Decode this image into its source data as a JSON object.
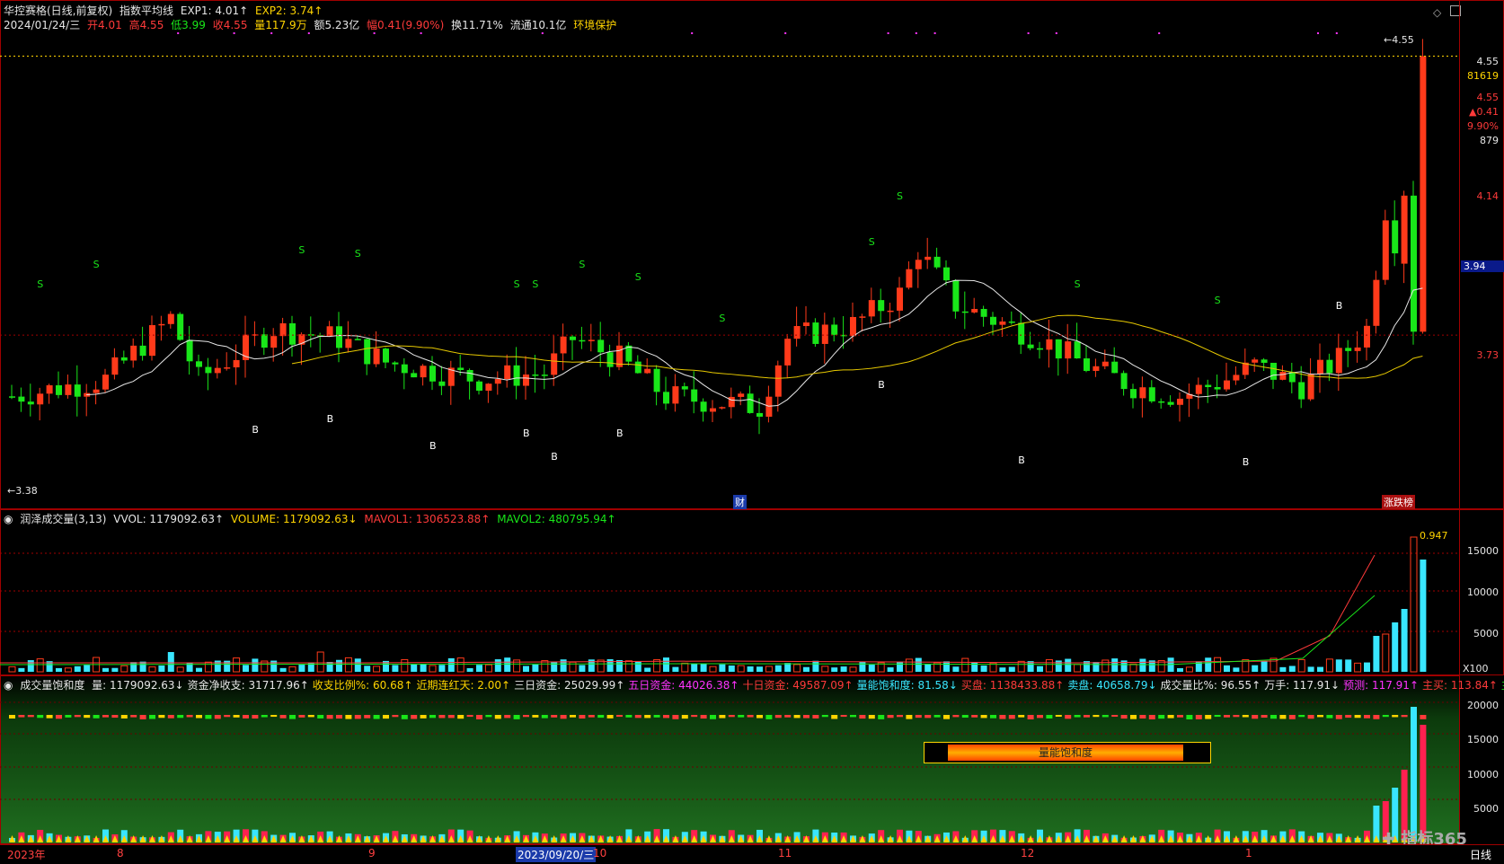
{
  "header": {
    "stock": "华控赛格(日线,前复权)",
    "indicator_name": "指数平均线",
    "exp1": "EXP1: 4.01↑",
    "exp2": "EXP2: 3.74↑",
    "date": "2024/01/24/三",
    "open": "开4.01",
    "high": "高4.55",
    "low": "低3.99",
    "close": "收4.55",
    "vol": "量117.9万",
    "amount": "额5.23亿",
    "change": "幅0.41(9.90%)",
    "turnover": "换11.71%",
    "float": "流通10.1亿",
    "tag": "环境保护"
  },
  "price_axis": {
    "top_price": "4.55",
    "vol_value": "81619",
    "price2": "4.55",
    "change": "▲0.41",
    "pct": "9.90%",
    "count": "879",
    "t1": "4.14",
    "t2": "3.94",
    "t3": "3.73",
    "low_label": "←3.38",
    "high_label": "←4.55"
  },
  "markers": {
    "cai": "财",
    "zhangdie": "涨跌榜"
  },
  "vol_panel": {
    "name": "润泽成交量(3,13)",
    "vvol": "VVOL: 1179092.63↑",
    "volume": "VOLUME: 1179092.63↓",
    "mavol1": "MAVOL1: 1306523.88↑",
    "mavol2": "MAVOL2: 480795.94↑",
    "ratio": "0.947",
    "ticks": [
      "15000",
      "10000",
      "5000"
    ],
    "unit": "X100"
  },
  "sat_panel": {
    "name": "成交量饱和度",
    "items": [
      {
        "t": "量: 1179092.63↓",
        "c": "w"
      },
      {
        "t": "资金净收支: 31717.96↑",
        "c": "w"
      },
      {
        "t": "收支比例%: 60.68↑",
        "c": "y"
      },
      {
        "t": "近期连红天: 2.00↑",
        "c": "y"
      },
      {
        "t": "三日资金: 25029.99↑",
        "c": "w"
      },
      {
        "t": "五日资金: 44026.38↑",
        "c": "m"
      },
      {
        "t": "十日资金: 49587.09↑",
        "c": "r"
      },
      {
        "t": "量能饱和度: 81.58↓",
        "c": "c"
      },
      {
        "t": "买盘: 1138433.88↑",
        "c": "r"
      },
      {
        "t": "卖盘: 40658.79↓",
        "c": "c"
      },
      {
        "t": "成交量比%: 96.55↑",
        "c": "w"
      },
      {
        "t": "万手: 117.91↓",
        "c": "w"
      },
      {
        "t": "预测: 117.91↑",
        "c": "m"
      },
      {
        "t": "主买: 113.84↑",
        "c": "r"
      },
      {
        "t": "主卖:",
        "c": "g"
      }
    ],
    "ticks": [
      "20000",
      "15000",
      "10000",
      "5000"
    ],
    "label": "量能饱和度"
  },
  "dates": {
    "d0": "2023年",
    "d1": "8",
    "d2": "9",
    "d3": "2023/09/20/三",
    "d4": "10",
    "d5": "11",
    "d6": "12",
    "d7": "1",
    "period": "日线"
  },
  "watermark": "指标365",
  "colors": {
    "up": "#ff3a1a",
    "down": "#19e619",
    "bg": "#000000",
    "border": "#a00000"
  }
}
